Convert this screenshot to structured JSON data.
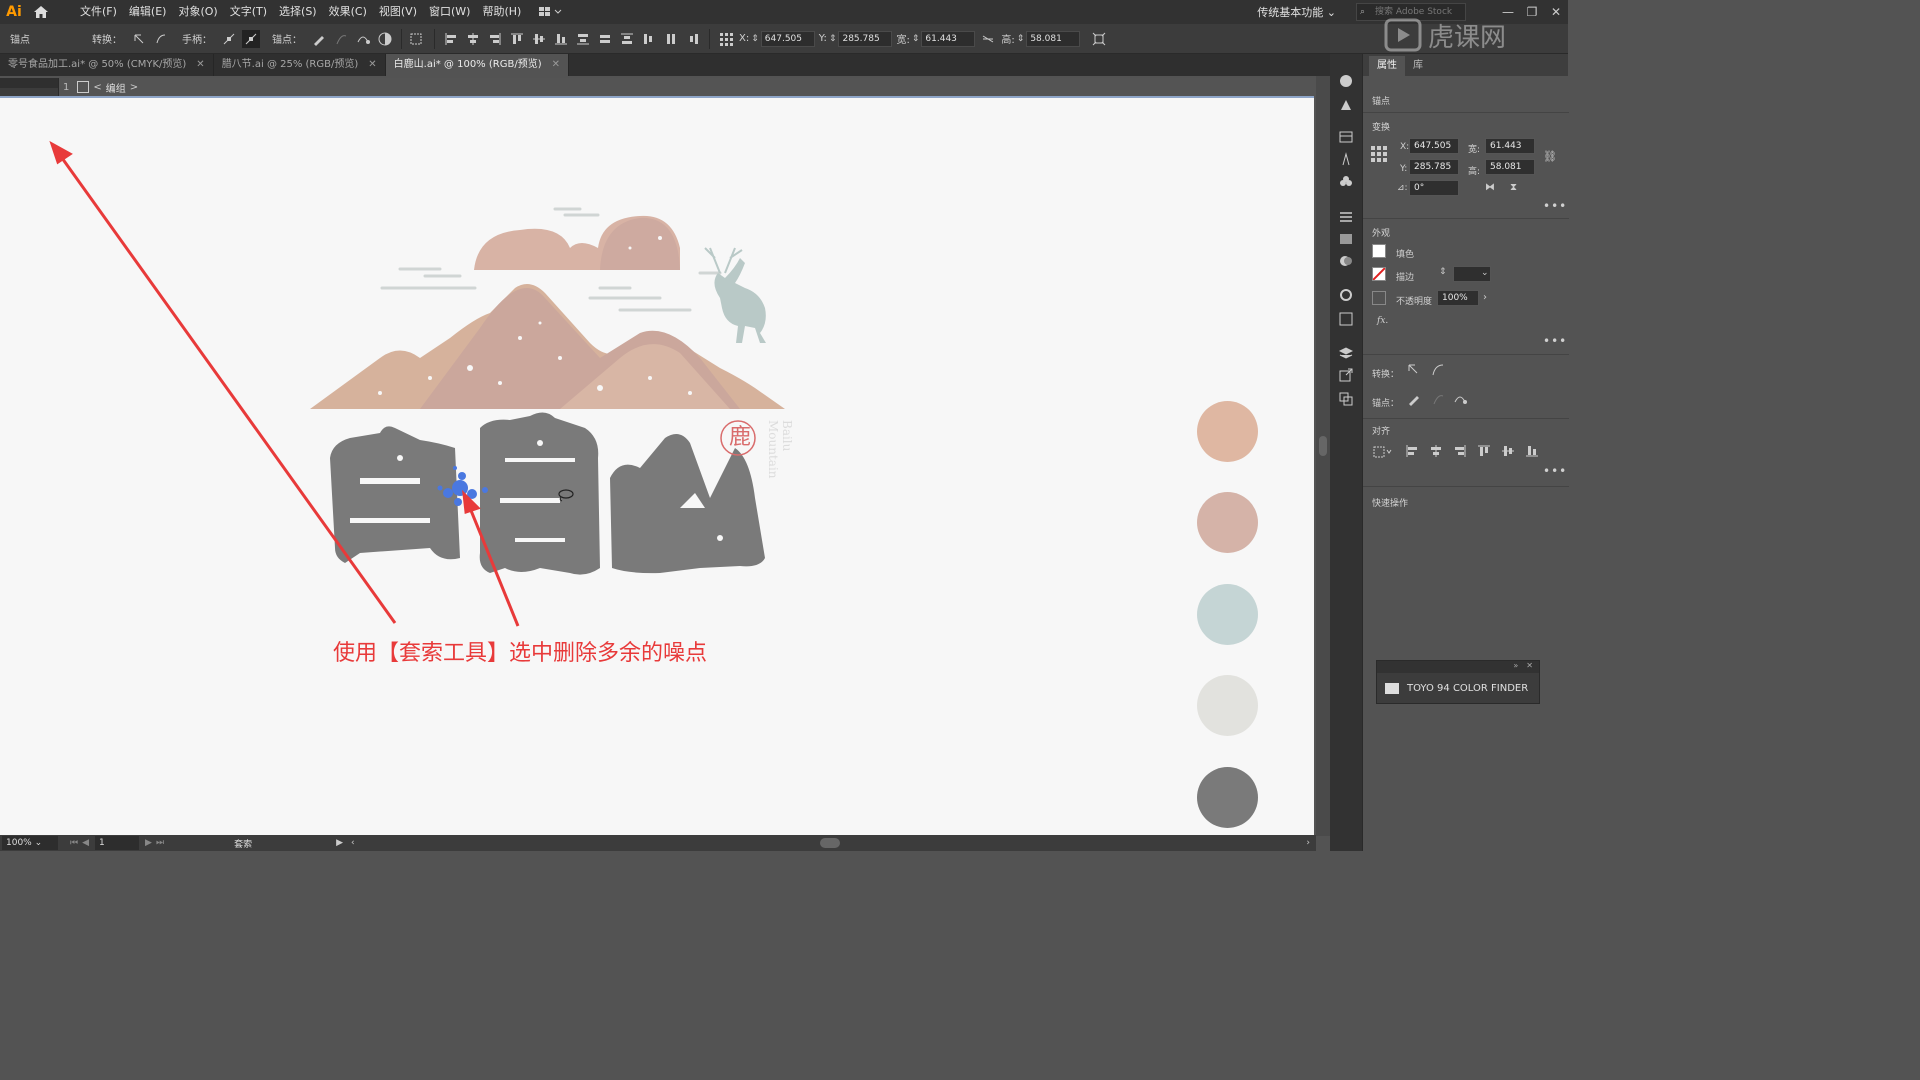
{
  "app": {
    "logo": "Ai",
    "menus": [
      "文件(F)",
      "编辑(E)",
      "对象(O)",
      "文字(T)",
      "选择(S)",
      "效果(C)",
      "视图(V)",
      "窗口(W)",
      "帮助(H)"
    ],
    "workspace": "传统基本功能",
    "stock_placeholder": "搜索 Adobe Stock"
  },
  "controlbar": {
    "anchor_label": "锚点",
    "convert_label": "转换：",
    "handle_label": "手柄：",
    "anchors_label": "锚点：",
    "x_label": "X:",
    "x_value": "647.505",
    "y_label": "Y:",
    "y_value": "285.785",
    "w_label": "宽:",
    "w_value": "61.443",
    "h_label": "高:",
    "h_value": "58.081"
  },
  "tabs": [
    {
      "label": "零号食品加工.ai* @ 50% (CMYK/预览)",
      "active": false
    },
    {
      "label": "腊八节.ai @ 25% (RGB/预览)",
      "active": false
    },
    {
      "label": "白鹿山.ai* @ 100% (RGB/预览)",
      "active": true
    }
  ],
  "breadcrumb": {
    "group": "编组"
  },
  "canvas": {
    "annotation": "使用【套索工具】选中删除多余的噪点",
    "logo_seal_text": "鹿",
    "logo_vertical_text": "Bailu Mountain",
    "title_chars": [
      "白",
      "鹿",
      "山"
    ]
  },
  "swatches": [
    "#dfb7a2",
    "#d5b3a8",
    "#c5d5d5",
    "#e2e2de",
    "#7a7a7a"
  ],
  "properties": {
    "tab_props": "属性",
    "tab_lib": "库",
    "section_anchor": "锚点",
    "section_transform": "变换",
    "x_label": "X:",
    "x_value": "647.505",
    "y_label": "Y:",
    "y_value": "285.785",
    "w_label": "宽:",
    "w_value": "61.443",
    "h_label": "高:",
    "h_value": "58.081",
    "angle_value": "0°",
    "section_appearance": "外观",
    "fill_label": "填色",
    "stroke_label": "描边",
    "opacity_label": "不透明度",
    "opacity_value": "100%",
    "fx_label": "fx.",
    "section_convert": "转换：",
    "section_anchors": "锚点：",
    "section_align": "对齐",
    "section_quick": "快速操作"
  },
  "colorfinder": {
    "title": "TOYO 94 COLOR FINDER"
  },
  "status": {
    "zoom": "100%",
    "page": "1",
    "tool": "套索"
  },
  "watermark": {
    "text": "虎课网"
  }
}
